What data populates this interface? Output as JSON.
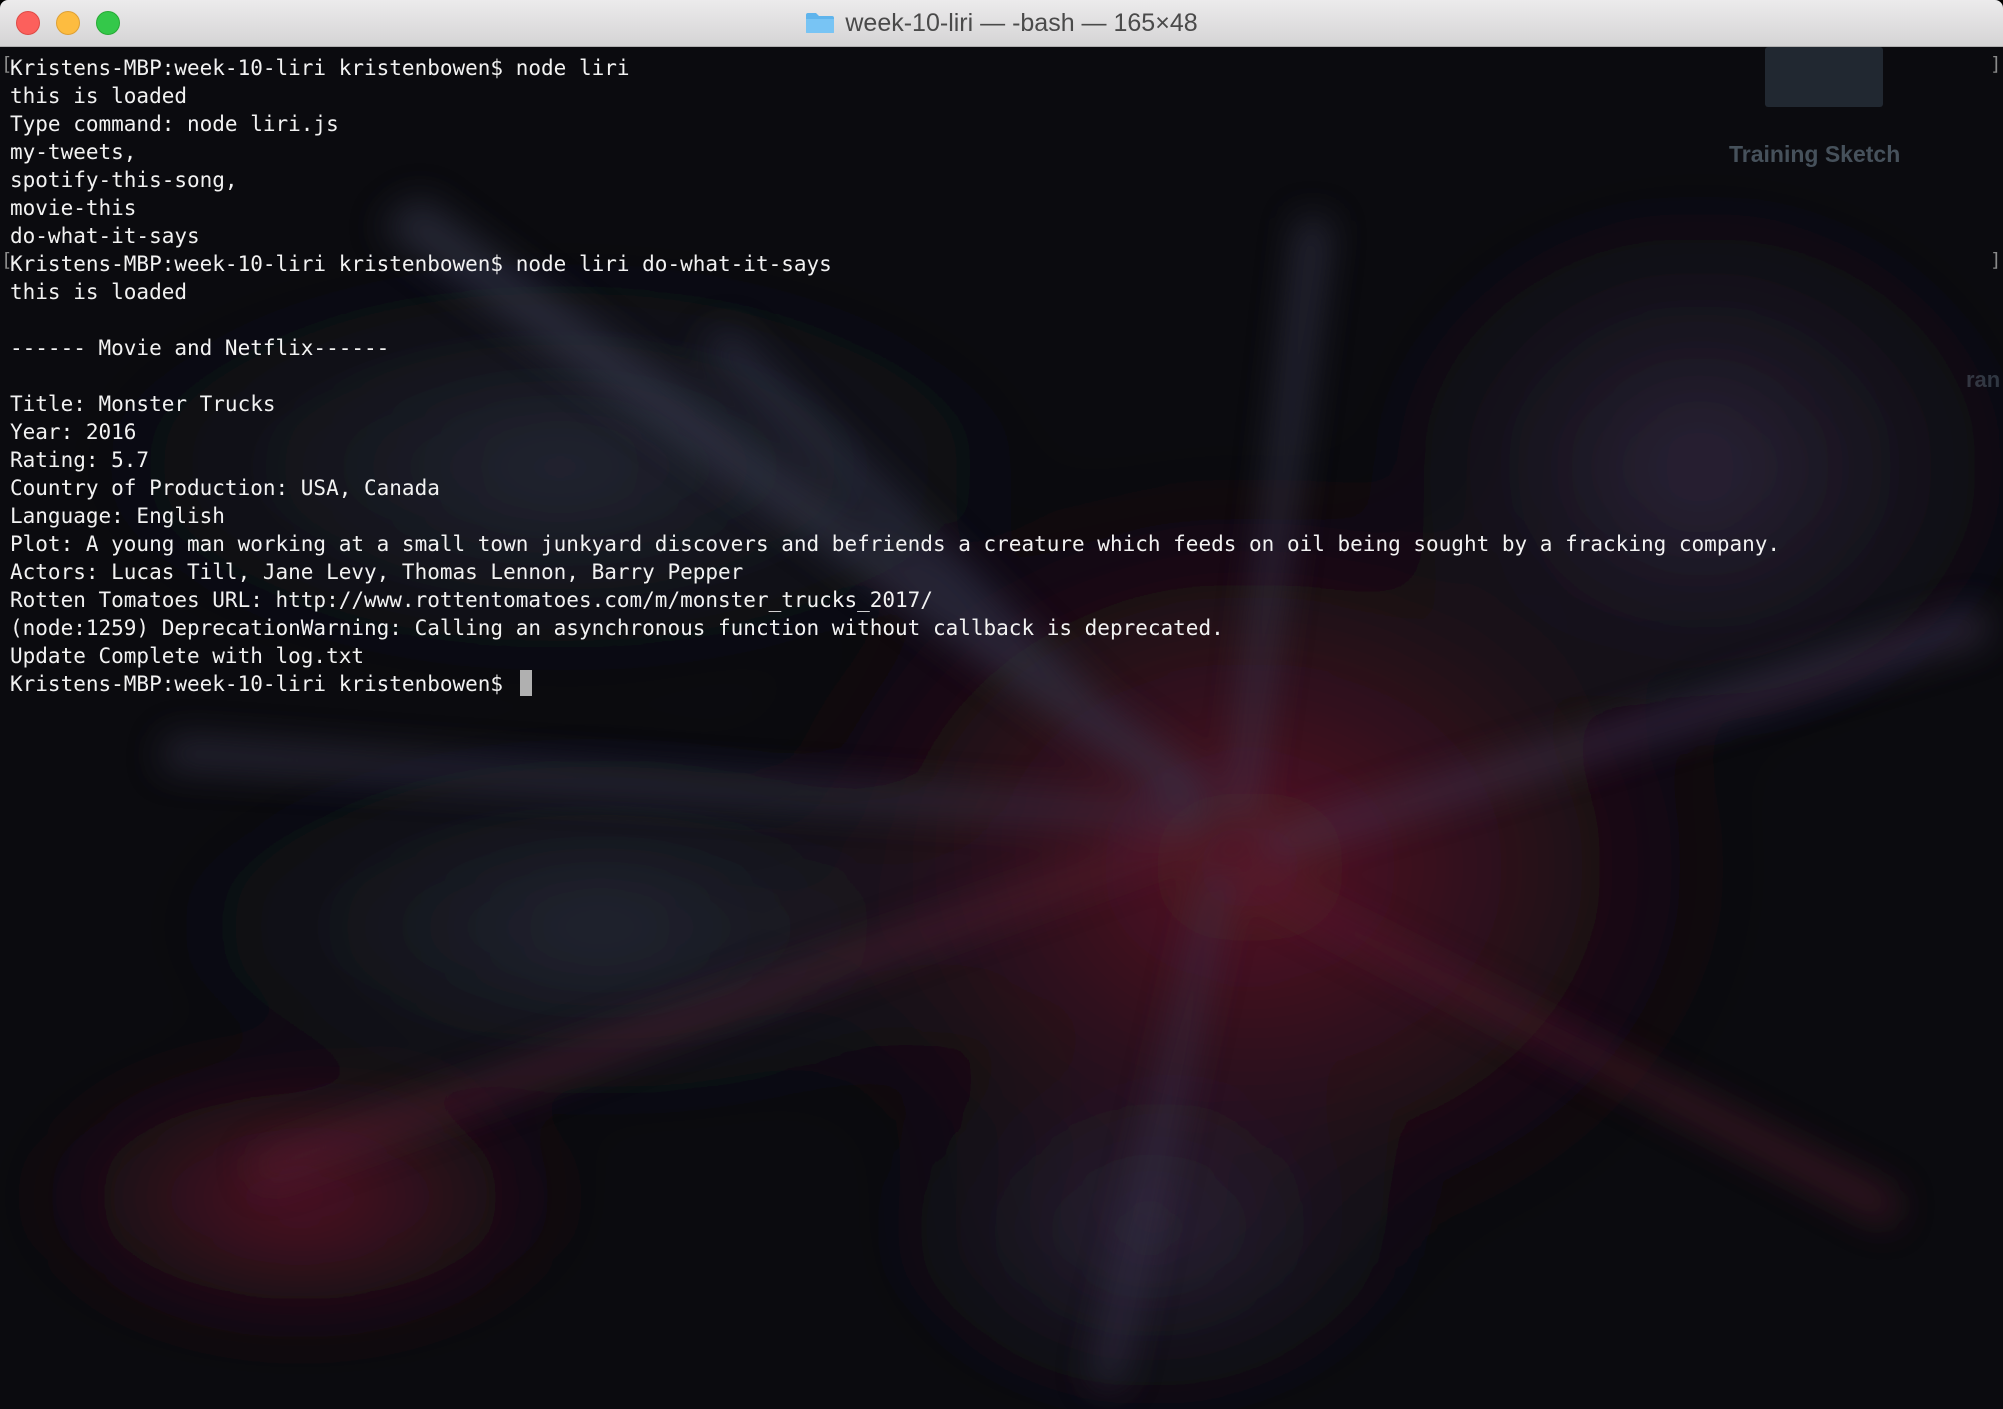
{
  "window": {
    "title": "week-10-liri — -bash — 165×48"
  },
  "background": {
    "ghost_label": "Training Sketch",
    "ghost_edge_text": "ran"
  },
  "terminal": {
    "lines": [
      "Kristens-MBP:week-10-liri kristenbowen$ node liri",
      "this is loaded",
      "Type command: node liri.js",
      "my-tweets,",
      "spotify-this-song,",
      "movie-this",
      "do-what-it-says",
      "Kristens-MBP:week-10-liri kristenbowen$ node liri do-what-it-says",
      "this is loaded",
      "",
      "------ Movie and Netflix------",
      "",
      "Title: Monster Trucks",
      "Year: 2016",
      "Rating: 5.7",
      "Country of Production: USA, Canada",
      "Language: English",
      "Plot: A young man working at a small town junkyard discovers and befriends a creature which feeds on oil being sought by a fracking company.",
      "Actors: Lucas Till, Jane Levy, Thomas Lennon, Barry Pepper",
      "Rotten Tomatoes URL: http://www.rottentomatoes.com/m/monster_trucks_2017/",
      "(node:1259) DeprecationWarning: Calling an asynchronous function without callback is deprecated.",
      "Update Complete with log.txt"
    ],
    "prompt": "Kristens-MBP:week-10-liri kristenbowen$ "
  },
  "colors": {
    "text": "#f2f2f2",
    "background": "#0c0c10",
    "close_button": "#fc605c",
    "minimize_button": "#fdbc40",
    "zoom_button": "#34c84a"
  }
}
